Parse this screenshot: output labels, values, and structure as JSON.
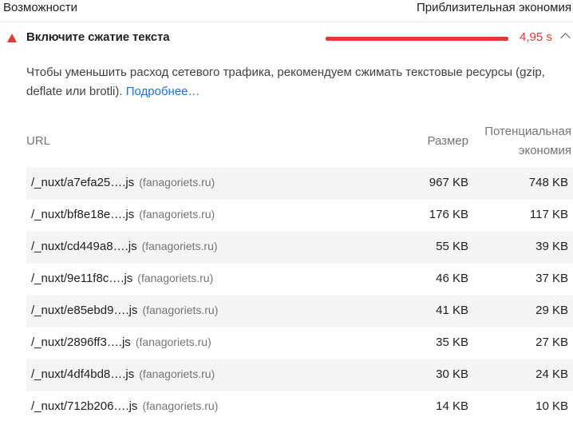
{
  "header": {
    "left": "Возможности",
    "right": "Приблизительная экономия"
  },
  "audit": {
    "title": "Включите сжатие текста",
    "savings": "4,95 s",
    "status_color": "#e53935",
    "description": "Чтобы уменьшить расход сетевого трафика, рекомендуем сжимать текстовые ресурсы (gzip, deflate или brotli).",
    "learn_more": "Подробнее…"
  },
  "table": {
    "columns": {
      "url": "URL",
      "size": "Размер",
      "potential_line1": "Потенциальная",
      "potential_line2": "экономия"
    },
    "rows": [
      {
        "url": "/_nuxt/a7efa25….js",
        "host": "(fanagoriets.ru)",
        "size": "967 KB",
        "savings": "748 KB"
      },
      {
        "url": "/_nuxt/bf8e18e….js",
        "host": "(fanagoriets.ru)",
        "size": "176 KB",
        "savings": "117 KB"
      },
      {
        "url": "/_nuxt/cd449a8….js",
        "host": "(fanagoriets.ru)",
        "size": "55 KB",
        "savings": "39 KB"
      },
      {
        "url": "/_nuxt/9e11f8c….js",
        "host": "(fanagoriets.ru)",
        "size": "46 KB",
        "savings": "37 KB"
      },
      {
        "url": "/_nuxt/e85ebd9….js",
        "host": "(fanagoriets.ru)",
        "size": "41 KB",
        "savings": "29 KB"
      },
      {
        "url": "/_nuxt/2896ff3….js",
        "host": "(fanagoriets.ru)",
        "size": "35 KB",
        "savings": "27 KB"
      },
      {
        "url": "/_nuxt/4df4bd8….js",
        "host": "(fanagoriets.ru)",
        "size": "30 KB",
        "savings": "24 KB"
      },
      {
        "url": "/_nuxt/712b206….js",
        "host": "(fanagoriets.ru)",
        "size": "14 KB",
        "savings": "10 KB"
      }
    ]
  }
}
